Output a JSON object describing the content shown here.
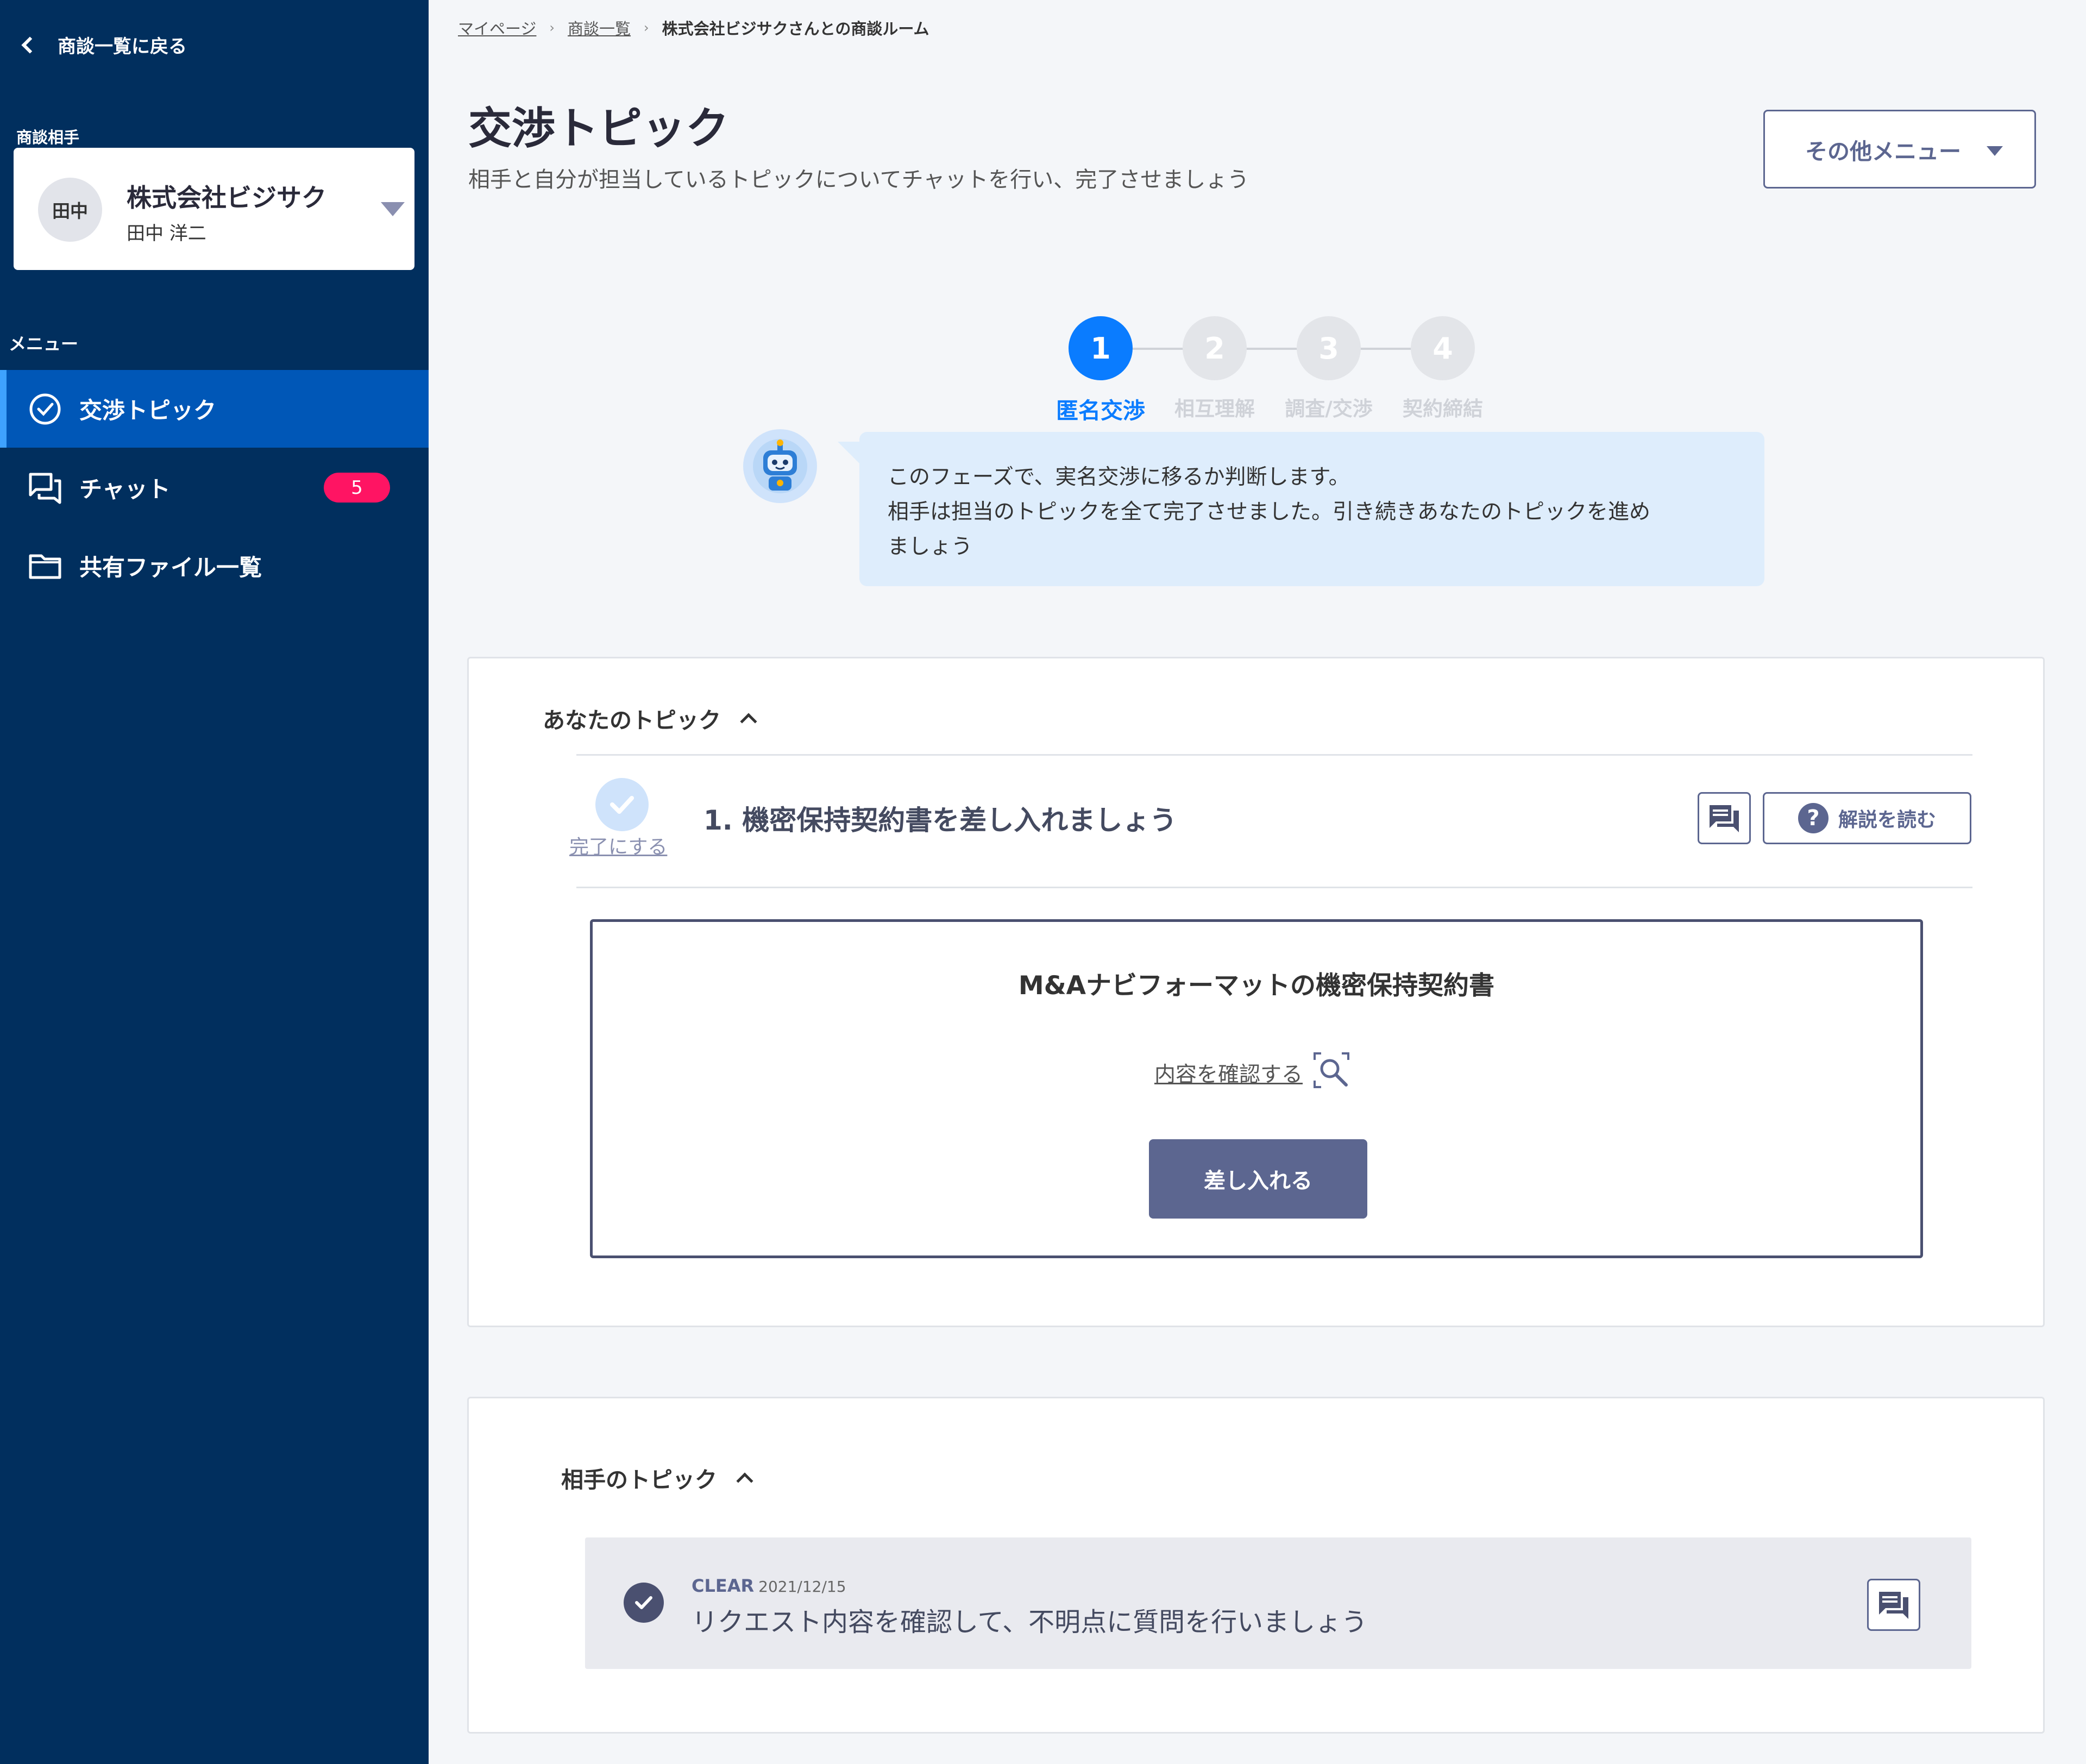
{
  "sidebar": {
    "back_label": "商談一覧に戻る",
    "partner_label": "商談相手",
    "partner": {
      "avatar_text": "田中",
      "company": "株式会社ビジサク",
      "person": "田中 洋二"
    },
    "menu_label": "メニュー",
    "items": [
      {
        "label": "交渉トピック",
        "icon": "check-circle-icon",
        "active": true
      },
      {
        "label": "チャット",
        "icon": "chat-icon",
        "badge": "5"
      },
      {
        "label": "共有ファイル一覧",
        "icon": "folder-icon"
      }
    ]
  },
  "breadcrumb": {
    "items": [
      "マイページ",
      "商談一覧"
    ],
    "current": "株式会社ビジサクさんとの商談ルーム"
  },
  "header": {
    "title": "交渉トピック",
    "subtitle": "相手と自分が担当しているトピックについてチャットを行い、完了させましょう",
    "other_menu": "その他メニュー"
  },
  "stepper": {
    "steps": [
      {
        "number": "1",
        "label": "匿名交渉",
        "active": true
      },
      {
        "number": "2",
        "label": "相互理解"
      },
      {
        "number": "3",
        "label": "調査/交渉"
      },
      {
        "number": "4",
        "label": "契約締結"
      }
    ]
  },
  "bot_message": {
    "lines": [
      "このフェーズで、実名交渉に移るか判断します。",
      "相手は担当のトピックを全て完了させました。引き続きあなたのトピックを進め",
      "ましょう"
    ]
  },
  "your_topics": {
    "title": "あなたのトピック",
    "complete_label": "完了にする",
    "topic_title": "1. 機密保持契約書を差し入れましょう",
    "guide_label": "解説を読む",
    "document": {
      "title": "M&Aナビフォーマットの機密保持契約書",
      "view_label": "内容を確認する",
      "submit_label": "差し入れる"
    }
  },
  "partner_topics": {
    "title": "相手のトピック",
    "item": {
      "status": "CLEAR",
      "date": "2021/12/15",
      "text": "リクエスト内容を確認して、不明点に質問を行いましょう"
    }
  },
  "colors": {
    "sidebar": "#012f5e",
    "active_nav": "#0057b7",
    "accent": "#0a7cff",
    "badge": "#ff1463",
    "button": "#5c6690"
  }
}
